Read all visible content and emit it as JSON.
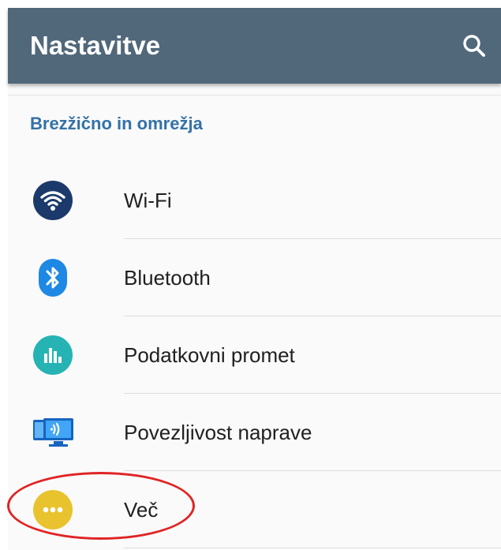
{
  "app_bar": {
    "title": "Nastavitve",
    "background": "#51677a",
    "search_icon": "search-icon"
  },
  "section": {
    "header": "Brezžično in omrežja",
    "header_color": "#3371a8"
  },
  "items": [
    {
      "label": "Wi-Fi",
      "icon": "wifi-icon",
      "icon_color": "#1b3a6b"
    },
    {
      "label": "Bluetooth",
      "icon": "bluetooth-icon",
      "icon_color": "#1e88e5"
    },
    {
      "label": "Podatkovni promet",
      "icon": "data-usage-icon",
      "icon_color": "#26b3b3"
    },
    {
      "label": "Povezljivost naprave",
      "icon": "device-connectivity-icon",
      "icon_color": "#1e88e5"
    },
    {
      "label": "Več",
      "icon": "more-icon",
      "icon_color": "#e8c32e"
    }
  ],
  "annotation": {
    "type": "red-ellipse-highlight",
    "target": "Več",
    "color": "#e02424"
  }
}
